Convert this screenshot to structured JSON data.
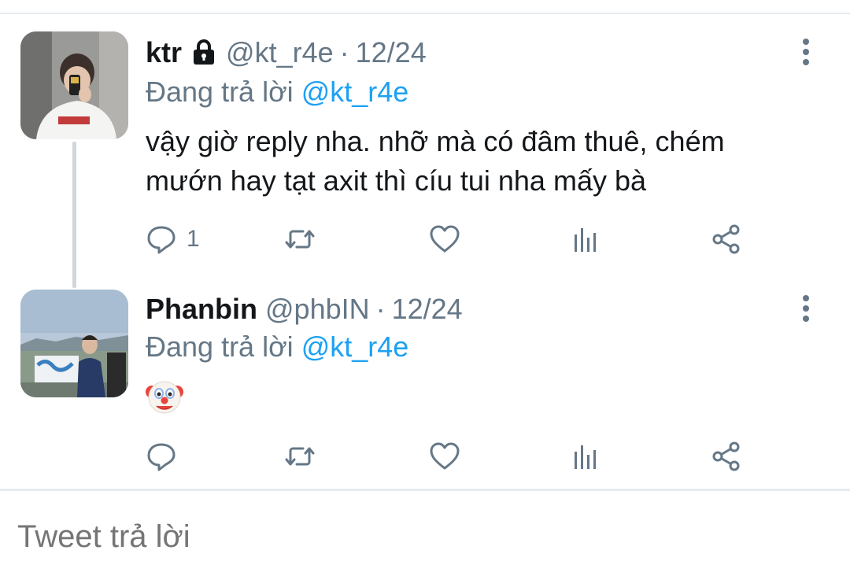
{
  "tweets": [
    {
      "display_name": "ktr",
      "handle": "@kt_r4e",
      "separator": "·",
      "date": "12/24",
      "replying_prefix": "Đang trả lời",
      "replying_to": "@kt_r4e",
      "text": "vậy giờ reply nha. nhỡ mà có đâm thuê, chém mướn hay tạt axit thì cíu tui nha mấy bà",
      "reply_count": "1",
      "protected": true
    },
    {
      "display_name": "Phanbin",
      "handle": "@phbIN",
      "separator": "·",
      "date": "12/24",
      "replying_prefix": "Đang trả lời",
      "replying_to": "@kt_r4e",
      "emoji": "clown-face",
      "reply_count": ""
    }
  ],
  "composer": {
    "placeholder": "Tweet trả lời"
  },
  "icons": {
    "reply": "reply-icon",
    "retweet": "retweet-icon",
    "like": "heart-icon",
    "analytics": "analytics-icon",
    "share": "share-icon",
    "more": "more-vertical-icon",
    "lock": "lock-icon"
  },
  "colors": {
    "mention": "#1da1f2",
    "muted": "#657786",
    "icon": "#657786"
  }
}
